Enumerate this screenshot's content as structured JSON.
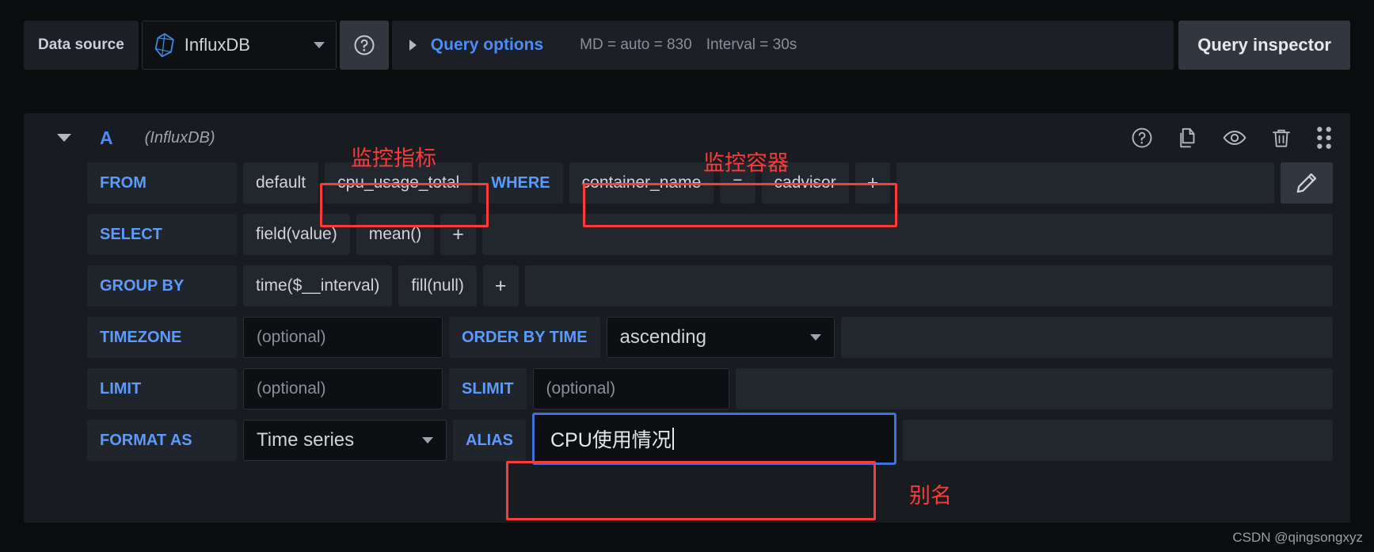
{
  "toolbar": {
    "data_source_label": "Data source",
    "datasource_name": "InfluxDB",
    "datasource_icon": "influxdb-logo-icon",
    "help_icon": "help-circle-icon",
    "query_options_caret": "caret-right-icon",
    "query_options_label": "Query options",
    "meta_md": "MD = auto = 830",
    "meta_interval": "Interval = 30s",
    "query_inspector_label": "Query inspector"
  },
  "query": {
    "collapse_icon": "chevron-down-icon",
    "ref_id": "A",
    "datasource_note": "(InfluxDB)",
    "actions": [
      {
        "name": "help-circle-icon",
        "title": "Help"
      },
      {
        "name": "copy-icon",
        "title": "Duplicate query"
      },
      {
        "name": "eye-icon",
        "title": "Toggle visibility"
      },
      {
        "name": "trash-icon",
        "title": "Remove query"
      },
      {
        "name": "drag-handle-icon",
        "title": "Drag to reorder"
      }
    ],
    "rows": {
      "from": {
        "keyword": "FROM",
        "policy": "default",
        "measurement": "cpu_usage_total",
        "where_keyword": "WHERE",
        "where_tag": "container_name",
        "where_operator": "=",
        "where_value": "cadvisor",
        "add_label": "+",
        "edit_icon": "pencil-icon"
      },
      "select": {
        "keyword": "SELECT",
        "field": "field(value)",
        "aggregation": "mean()",
        "add_label": "+"
      },
      "group_by": {
        "keyword": "GROUP BY",
        "time": "time($__interval)",
        "fill": "fill(null)",
        "add_label": "+"
      },
      "timezone": {
        "keyword": "TIMEZONE",
        "value": "(optional)",
        "order_keyword": "ORDER BY TIME",
        "order_value": "ascending",
        "order_chevron": "chevron-down-icon"
      },
      "limit": {
        "keyword": "LIMIT",
        "value": "(optional)",
        "slimit_keyword": "SLIMIT",
        "slimit_value": "(optional)"
      },
      "format": {
        "keyword": "FORMAT AS",
        "value": "Time series",
        "chevron": "chevron-down-icon",
        "alias_keyword": "ALIAS",
        "alias_value": "CPU使用情况"
      }
    }
  },
  "annotations": {
    "metric_note": "监控指标",
    "container_note": "监控容器",
    "alias_note": "别名",
    "color": "#fb3b3b"
  },
  "watermark": "CSDN @qingsongxyz"
}
